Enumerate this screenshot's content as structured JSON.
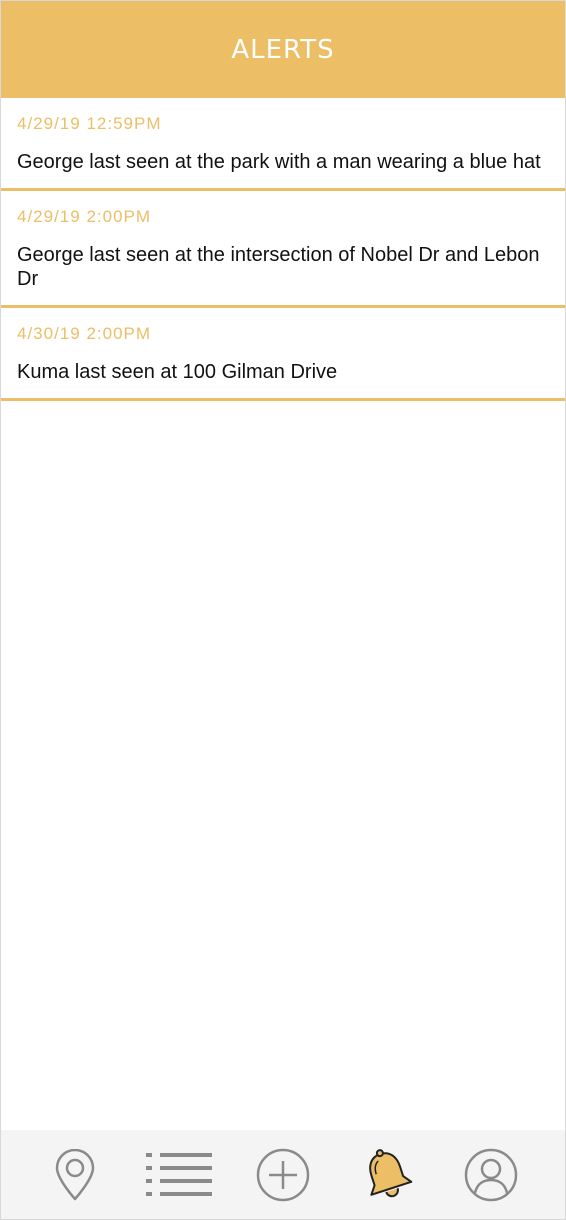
{
  "header": {
    "title": "ALERTS"
  },
  "alerts": [
    {
      "time": "4/29/19 12:59PM",
      "text": "George last seen at the park with a man wearing a blue hat"
    },
    {
      "time": "4/29/19 2:00PM",
      "text": "George last seen at the intersection of Nobel Dr and Lebon Dr"
    },
    {
      "time": "4/30/19 2:00PM",
      "text": "Kuma last seen at 100 Gilman Drive"
    }
  ],
  "nav": {
    "items": [
      {
        "icon": "location-pin-icon",
        "active": false
      },
      {
        "icon": "list-icon",
        "active": false
      },
      {
        "icon": "add-circle-icon",
        "active": false
      },
      {
        "icon": "bell-icon",
        "active": true
      },
      {
        "icon": "profile-icon",
        "active": false
      }
    ]
  },
  "colors": {
    "accent": "#ecbe66",
    "nav_icon": "#8a8a8a",
    "nav_background": "#f4f4f4",
    "text": "#111111"
  }
}
